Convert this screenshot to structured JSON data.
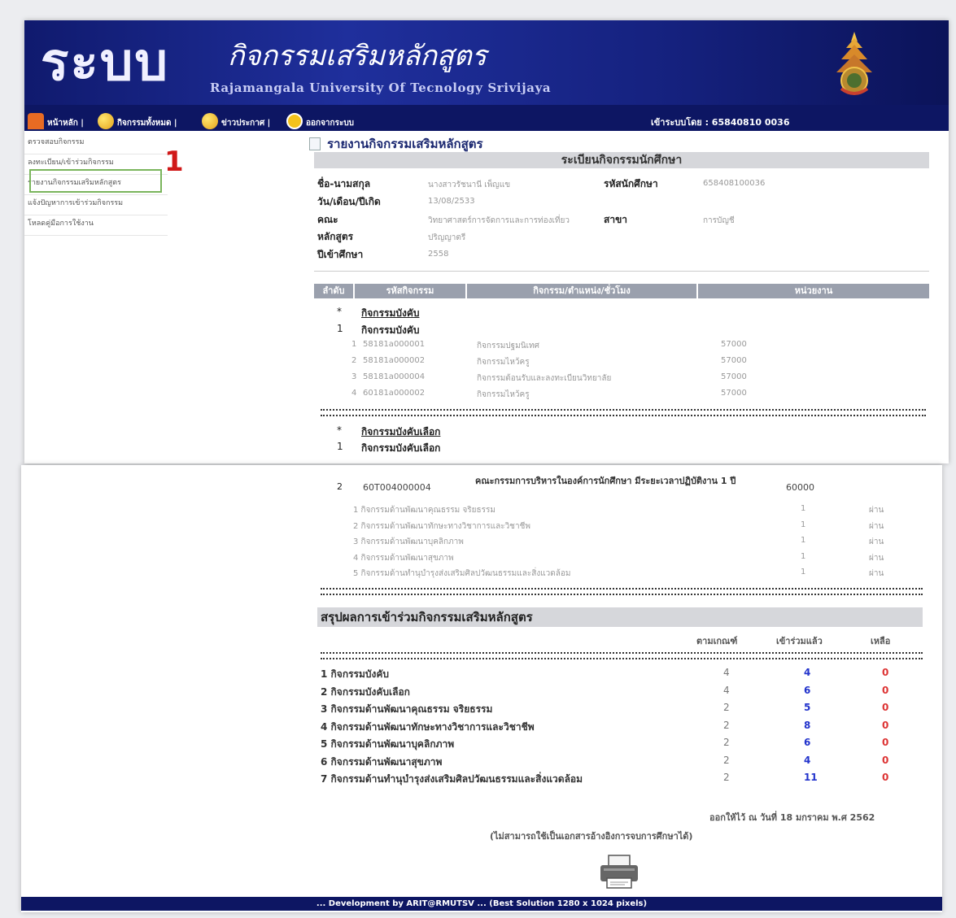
{
  "header": {
    "system_word": "ระบบ",
    "subtitle": "กิจกรรมเสริมหลักสูตร",
    "university": "Rajamangala University Of Tecnology Srivijaya"
  },
  "nav": {
    "items": [
      "หน้าหลัก |",
      "กิจกรรมทั้งหมด |",
      "ข่าวประกาศ |",
      "ออกจากระบบ"
    ],
    "login": "เข้าระบบโดย : 65840810 0036"
  },
  "sidebar": {
    "items": [
      "ตรวจสอบกิจกรรม",
      "ลงทะเบียน/เข้าร่วมกิจกรรม",
      "รายงานกิจกรรมเสริมหลักสูตร",
      "แจ้งปัญหาการเข้าร่วมกิจกรรม",
      "โหลดคู่มือการใช้งาน"
    ],
    "marker": "1"
  },
  "report": {
    "title": "รายงานกิจกรรมเสริมหลักสูตร",
    "section_title": "ระเบียนกิจกรรมนักศึกษา",
    "labels": {
      "name": "ชื่อ-นามสกุล",
      "birth": "วัน/เดือน/ปีเกิด",
      "faculty": "คณะ",
      "curriculum": "หลักสูตร",
      "year": "ปีเข้าศึกษา",
      "student_id": "รหัสนักศึกษา",
      "major": "สาขา"
    },
    "values": {
      "name": "นางสาวรัชนานี เพ็ญแข",
      "birth": "13/08/2533",
      "faculty": "วิทยาศาสตร์การจัดการและการท่องเที่ยว",
      "curriculum": "ปริญญาตรี",
      "year": "2558",
      "student_id": "658408100036",
      "major": "การบัญชี"
    },
    "table_headers": [
      "ลำดับ",
      "รหัสกิจกรรม",
      "กิจกรรม/ตำแหน่ง/ชั่วโมง",
      "หน่วยงาน"
    ],
    "group1": {
      "marker": "*",
      "title": "กิจกรรมบังคับ",
      "num": "1",
      "name": "กิจกรรมบังคับ"
    },
    "group1_rows": [
      {
        "no": "1",
        "code": "58181a000001",
        "name": "กิจกรรมปฐมนิเทศ",
        "unit": "57000"
      },
      {
        "no": "2",
        "code": "58181a000002",
        "name": "กิจกรรมไหว้ครู",
        "unit": "57000"
      },
      {
        "no": "3",
        "code": "58181a000004",
        "name": "กิจกรรมต้อนรับและลงทะเบียนวิทยาลัย",
        "unit": "57000"
      },
      {
        "no": "4",
        "code": "60181a000002",
        "name": "กิจกรรมไหว้ครู",
        "unit": "57000"
      }
    ],
    "group2": {
      "marker": "*",
      "title": "กิจกรรมบังคับเลือก",
      "num": "1",
      "name": "กิจกรรมบังคับเลือก"
    }
  },
  "page2": {
    "item2": {
      "num": "2",
      "code": "60T004000004",
      "name": "คณะกรรมการบริหารในองค์การนักศึกษา มีระยะเวลาปฏิบัติงาน 1 ปี",
      "unit": "60000"
    },
    "item2_rows": [
      {
        "text": "1 กิจกรรมด้านพัฒนาคุณธรรม จริยธรรม",
        "count": "1",
        "status": "ผ่าน"
      },
      {
        "text": "2 กิจกรรมด้านพัฒนาทักษะทางวิชาการและวิชาชีพ",
        "count": "1",
        "status": "ผ่าน"
      },
      {
        "text": "3 กิจกรรมด้านพัฒนาบุคลิกภาพ",
        "count": "1",
        "status": "ผ่าน"
      },
      {
        "text": "4 กิจกรรมด้านพัฒนาสุขภาพ",
        "count": "1",
        "status": "ผ่าน"
      },
      {
        "text": "5 กิจกรรมด้านทำนุบำรุงส่งเสริมศิลปวัฒนธรรมและสิ่งแวดล้อม",
        "count": "1",
        "status": "ผ่าน"
      }
    ],
    "summary_title": "สรุปผลการเข้าร่วมกิจกรรมเสริมหลักสูตร",
    "summary_cols": [
      "ตามเกณฑ์",
      "เข้าร่วมแล้ว",
      "เหลือ"
    ],
    "summary_rows": [
      {
        "name": "1 กิจกรรมบังคับ",
        "req": "4",
        "done": "4",
        "left": "0"
      },
      {
        "name": "2 กิจกรรมบังคับเลือก",
        "req": "4",
        "done": "6",
        "left": "0"
      },
      {
        "name": "3 กิจกรรมด้านพัฒนาคุณธรรม จริยธรรม",
        "req": "2",
        "done": "5",
        "left": "0"
      },
      {
        "name": "4 กิจกรรมด้านพัฒนาทักษะทางวิชาการและวิชาชีพ",
        "req": "2",
        "done": "8",
        "left": "0"
      },
      {
        "name": "5 กิจกรรมด้านพัฒนาบุคลิกภาพ",
        "req": "2",
        "done": "6",
        "left": "0"
      },
      {
        "name": "6 กิจกรรมด้านพัฒนาสุขภาพ",
        "req": "2",
        "done": "4",
        "left": "0"
      },
      {
        "name": "7 กิจกรรมด้านทำนุบำรุงส่งเสริมศิลปวัฒนธรรมและสิ่งแวดล้อม",
        "req": "2",
        "done": "11",
        "left": "0"
      }
    ],
    "printed_on": "ออกให้ไว้ ณ วันที่ 18 มกราคม พ.ศ 2562",
    "note": "(ไม่สามารถใช้เป็นเอกสารอ้างอิงการจบการศึกษาได้)",
    "footer": "... Development by ARIT@RMUTSV ...   (Best Solution 1280 x 1024 pixels)"
  },
  "colors": {
    "banner": "#1f2f9c",
    "navbar": "#0d1663",
    "done": "#2233cc",
    "left": "#dd3333",
    "highlight": "#7ab55c",
    "marker": "#d01818"
  }
}
